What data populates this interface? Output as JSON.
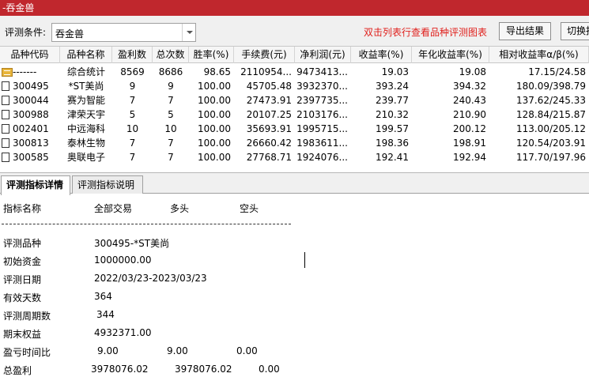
{
  "window": {
    "title": "-吞金兽"
  },
  "toolbar": {
    "condition_label": "评测条件:",
    "condition_value": "吞金兽",
    "hint": "双击列表行查看品种评测图表",
    "export_label": "导出结果",
    "switch_label": "切换报"
  },
  "table": {
    "headers": [
      "品种代码",
      "品种名称",
      "盈利数",
      "总次数",
      "胜率(%)",
      "手续费(元)",
      "净利润(元)",
      "收益率(%)",
      "年化收益率(%)",
      "相对收益率α/β(%)"
    ],
    "rows": [
      {
        "code": "-------",
        "name": "综合统计",
        "wins": "8569",
        "total": "8686",
        "winrate": "98.65",
        "fee": "2110954...",
        "profit": "9473413...",
        "ret": "19.03",
        "annual": "19.08",
        "relative": "17.15/24.58"
      },
      {
        "code": "300495",
        "name": "*ST美尚",
        "wins": "9",
        "total": "9",
        "winrate": "100.00",
        "fee": "45705.48",
        "profit": "3932370...",
        "ret": "393.24",
        "annual": "394.32",
        "relative": "180.09/398.79"
      },
      {
        "code": "300044",
        "name": "赛为智能",
        "wins": "7",
        "total": "7",
        "winrate": "100.00",
        "fee": "27473.91",
        "profit": "2397735...",
        "ret": "239.77",
        "annual": "240.43",
        "relative": "137.62/245.33"
      },
      {
        "code": "300988",
        "name": "津荣天宇",
        "wins": "5",
        "total": "5",
        "winrate": "100.00",
        "fee": "20107.25",
        "profit": "2103176...",
        "ret": "210.32",
        "annual": "210.90",
        "relative": "128.84/215.87"
      },
      {
        "code": "002401",
        "name": "中远海科",
        "wins": "10",
        "total": "10",
        "winrate": "100.00",
        "fee": "35693.91",
        "profit": "1995715...",
        "ret": "199.57",
        "annual": "200.12",
        "relative": "113.00/205.12"
      },
      {
        "code": "300813",
        "name": "泰林生物",
        "wins": "7",
        "total": "7",
        "winrate": "100.00",
        "fee": "26660.42",
        "profit": "1983611...",
        "ret": "198.36",
        "annual": "198.91",
        "relative": "120.54/203.91"
      },
      {
        "code": "300585",
        "name": "奥联电子",
        "wins": "7",
        "total": "7",
        "winrate": "100.00",
        "fee": "27768.71",
        "profit": "1924076...",
        "ret": "192.41",
        "annual": "192.94",
        "relative": "117.70/197.96"
      }
    ]
  },
  "tabs": {
    "detail": "评测指标详情",
    "explain": "评测指标说明"
  },
  "detail": {
    "headers": {
      "name": "指标名称",
      "all": "全部交易",
      "long": "多头",
      "short": "空头"
    },
    "divider": "------------------------------------------------------------------------------------",
    "items": [
      {
        "label": "评测品种",
        "all": "300495-*ST美尚",
        "long": "",
        "short": ""
      },
      {
        "label": "初始资金",
        "all": "1000000.00",
        "long": "",
        "short": ""
      },
      {
        "label": "评测日期",
        "all": "2022/03/23-2023/03/23",
        "long": "",
        "short": ""
      },
      {
        "label": "有效天数",
        "all": "364",
        "long": "",
        "short": ""
      },
      {
        "label": "评测周期数",
        "all": "344",
        "long": "",
        "short": ""
      },
      {
        "label": "期末权益",
        "all": "4932371.00",
        "long": "",
        "short": ""
      },
      {
        "label": "盈亏时间比",
        "all": "9.00",
        "long": "9.00",
        "short": "0.00"
      },
      {
        "label": "总盈利",
        "all": "3978076.02",
        "long": "3978076.02",
        "short": "0.00"
      }
    ]
  }
}
